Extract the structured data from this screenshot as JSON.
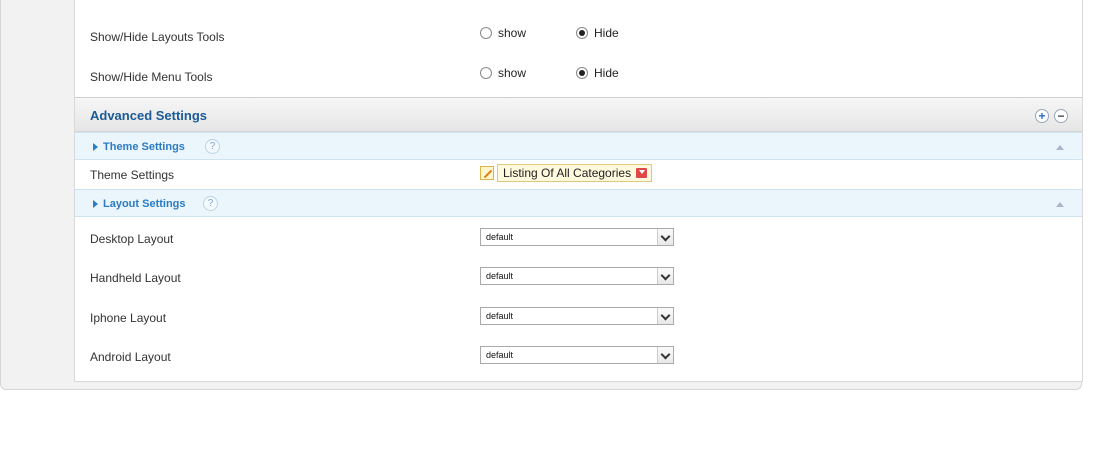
{
  "display_options": [
    {
      "label": "Show/Hide Layouts Tools",
      "option_show": "show",
      "option_hide": "Hide",
      "selected": "Hide"
    },
    {
      "label": "Show/Hide Menu Tools",
      "option_show": "show",
      "option_hide": "Hide",
      "selected": "Hide"
    }
  ],
  "advanced": {
    "title": "Advanced Settings",
    "expand_icon": "plus-circle-icon",
    "collapse_icon": "minus-circle-icon"
  },
  "theme_section": {
    "title": "Theme Settings",
    "help": "?",
    "field_label": "Theme Settings",
    "value": "Listing Of All Categories"
  },
  "layout_section": {
    "title": "Layout Settings",
    "help": "?",
    "fields": [
      {
        "label": "Desktop Layout",
        "value": "default"
      },
      {
        "label": "Handheld Layout",
        "value": "default"
      },
      {
        "label": "Iphone Layout",
        "value": "default"
      },
      {
        "label": "Android Layout",
        "value": "default"
      }
    ]
  },
  "colors": {
    "accent": "#1a5a96",
    "section_bg": "#eaf5fc",
    "section_text": "#2a7cc4"
  }
}
